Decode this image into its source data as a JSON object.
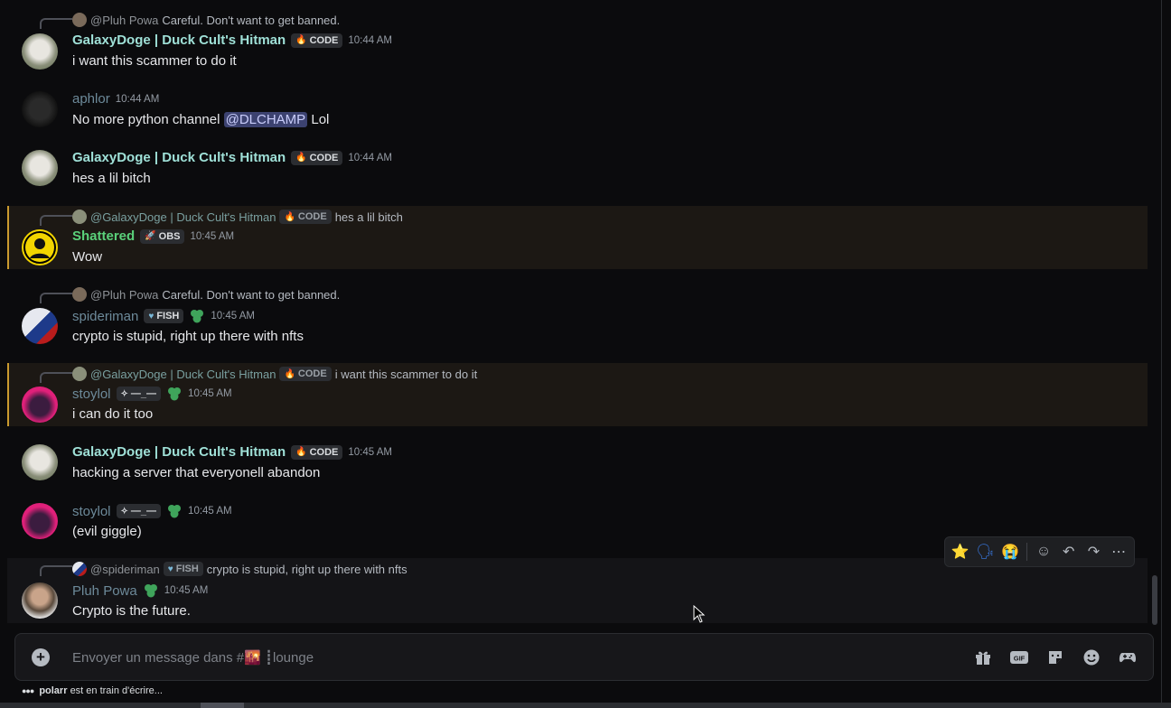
{
  "messages": [
    {
      "reply": {
        "name": "@Pluh Powa",
        "text": "Careful. Don't want to get banned."
      },
      "user": "GalaxyDoge | Duck Cult's Hitman",
      "tag": "CODE",
      "time": "10:44 AM",
      "text": "i want this scammer to do it"
    },
    {
      "user": "aphlor",
      "time": "10:44 AM",
      "text_before": "No more python channel ",
      "mention": "@DLCHAMP",
      "text_after": " Lol"
    },
    {
      "user": "GalaxyDoge | Duck Cult's Hitman",
      "tag": "CODE",
      "time": "10:44 AM",
      "text": "hes a lil bitch"
    },
    {
      "reply": {
        "name": "@GalaxyDoge | Duck Cult's Hitman",
        "tag": "CODE",
        "text": "hes a lil bitch"
      },
      "user": "Shattered",
      "tag": "OBS",
      "time": "10:45 AM",
      "text": "Wow"
    },
    {
      "reply": {
        "name": "@Pluh Powa",
        "text": "Careful. Don't want to get banned."
      },
      "user": "spideriman",
      "tag": "FISH",
      "time": "10:45 AM",
      "text": "crypto is stupid, right up there with nfts"
    },
    {
      "reply": {
        "name": "@GalaxyDoge | Duck Cult's Hitman",
        "tag": "CODE",
        "text": "i want this scammer to do it"
      },
      "user": "stoylol",
      "tag": "—_—",
      "time": "10:45 AM",
      "text": "i can do it too"
    },
    {
      "user": "GalaxyDoge | Duck Cult's Hitman",
      "tag": "CODE",
      "time": "10:45 AM",
      "text": "hacking a server that everyonell abandon"
    },
    {
      "user": "stoylol",
      "tag": "—_—",
      "time": "10:45 AM",
      "text": "(evil giggle)"
    },
    {
      "reply": {
        "name": "@spideriman",
        "tag": "FISH",
        "text": "crypto is stupid, right up there with nfts"
      },
      "user": "Pluh Powa",
      "time": "10:45 AM",
      "text": "Crypto is the future."
    }
  ],
  "hover_toolbar": {
    "icons": [
      "star-emoji",
      "speaking-head-emoji",
      "crying-emoji",
      "add-reaction-icon",
      "reply-icon",
      "forward-icon",
      "more-icon"
    ]
  },
  "composer": {
    "placeholder": "Envoyer un message dans #🌇 ┋lounge",
    "icons": [
      "gift-icon",
      "gif-icon",
      "sticker-icon",
      "emoji-icon",
      "apps-icon"
    ]
  },
  "typing": {
    "user": "polarr",
    "text": "est en train d'écrire..."
  },
  "colors": {
    "background": "#0b0b0d",
    "mention_highlight": "#1c1814",
    "mention_border": "#c99a2e",
    "galaxy_name": "#9fe0d7",
    "shattered_name": "#5ad07a",
    "mention_chip": "#3c4270"
  }
}
